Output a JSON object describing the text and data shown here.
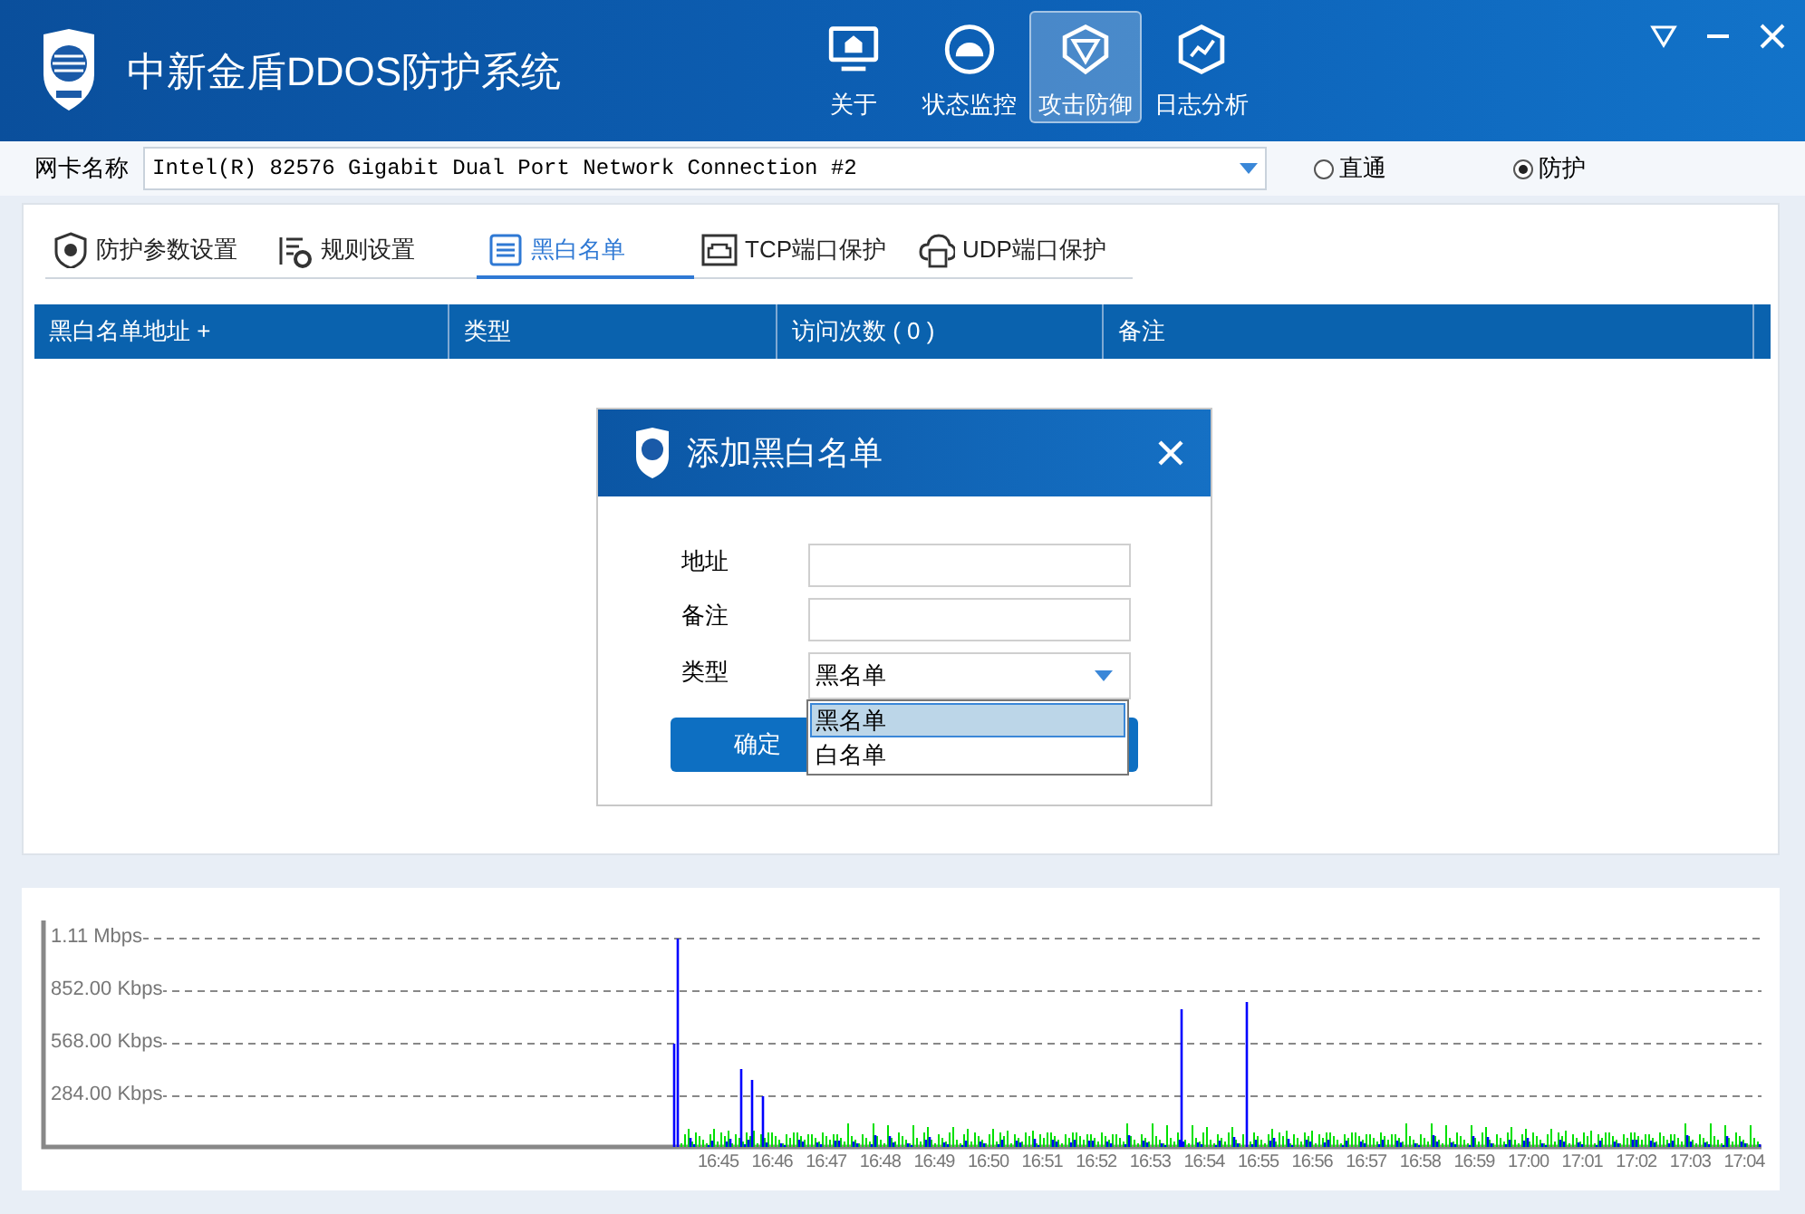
{
  "app": {
    "title": "中新金盾DDOS防护系统"
  },
  "nav": [
    {
      "label": "关于",
      "selected": false
    },
    {
      "label": "状态监控",
      "selected": false
    },
    {
      "label": "攻击防御",
      "selected": true
    },
    {
      "label": "日志分析",
      "selected": false
    }
  ],
  "nic": {
    "label": "网卡名称",
    "value": "Intel(R) 82576 Gigabit Dual Port Network Connection #2"
  },
  "modes": [
    {
      "label": "直通",
      "selected": false
    },
    {
      "label": "防护",
      "selected": true
    }
  ],
  "tabs": [
    {
      "label": "防护参数设置",
      "selected": false
    },
    {
      "label": "规则设置",
      "selected": false
    },
    {
      "label": "黑白名单",
      "selected": true
    },
    {
      "label": "TCP端口保护",
      "selected": false
    },
    {
      "label": "UDP端口保护",
      "selected": false
    }
  ],
  "table": {
    "columns": [
      "黑白名单地址 +",
      "类型",
      "访问次数 ( 0 )",
      "备注"
    ]
  },
  "dialog": {
    "title": "添加黑白名单",
    "fields": [
      {
        "label": "地址",
        "kind": "text"
      },
      {
        "label": "备注",
        "kind": "text"
      },
      {
        "label": "类型",
        "kind": "select",
        "value": "黑名单"
      }
    ],
    "options": [
      {
        "label": "黑名单",
        "selected": true
      },
      {
        "label": "白名单",
        "selected": false
      }
    ],
    "confirm": "确定"
  },
  "traffic_chart": {
    "y_labels": [
      "1.11 Mbps",
      "852.00 Kbps",
      "568.00 Kbps",
      "284.00 Kbps"
    ],
    "x_labels": [
      "16:45",
      "16:46",
      "16:47",
      "16:48",
      "16:49",
      "16:50",
      "16:51",
      "16:52",
      "16:53",
      "16:54",
      "16:55",
      "16:56",
      "16:57",
      "16:58",
      "16:59",
      "17:00",
      "17:01",
      "17:02",
      "17:03",
      "17:04"
    ]
  }
}
